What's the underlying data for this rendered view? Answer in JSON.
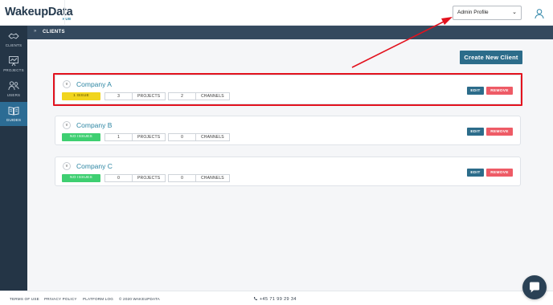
{
  "header": {
    "logo_main": "WakeupData",
    "logo_sub": "HUB",
    "profile_select_value": "Admin Profile",
    "user_icon": "user-icon"
  },
  "sidebar": {
    "items": [
      {
        "label": "CLIENTS",
        "icon": "clients-icon"
      },
      {
        "label": "PROJECTS",
        "icon": "projects-icon"
      },
      {
        "label": "USERS",
        "icon": "users-icon"
      },
      {
        "label": "GUIDES",
        "icon": "guides-icon",
        "active": true
      }
    ]
  },
  "breadcrumb": {
    "arrow": "»",
    "current": "CLIENTS"
  },
  "actions": {
    "create_label": "Create New Client"
  },
  "clients": [
    {
      "name": "Company A",
      "status": "1 ISSUE",
      "projects": "3",
      "channels": "2"
    },
    {
      "name": "Company B",
      "status": "NO ISSUES",
      "projects": "1",
      "channels": "0"
    },
    {
      "name": "Company C",
      "status": "NO ISSUES",
      "projects": "0",
      "channels": "0"
    }
  ],
  "labels": {
    "projects": "PROJECTS",
    "channels": "CHANNELS",
    "edit": "EDIT",
    "remove": "REMOVE",
    "toggle": "v"
  },
  "footer": {
    "terms": "TERMS OF USE",
    "privacy": "PRIVACY POLICY",
    "platform_log": "PLATFORM LOG",
    "copyright": "© 2020 WAKEUPDATA",
    "phone": "+45 71 99 29 34"
  },
  "colors": {
    "sidebar": "#243546",
    "accent": "#2c6c8a",
    "issue": "#f1d51e",
    "ok": "#3ecf71",
    "remove": "#ee5b66",
    "annotation": "#e3121e"
  }
}
